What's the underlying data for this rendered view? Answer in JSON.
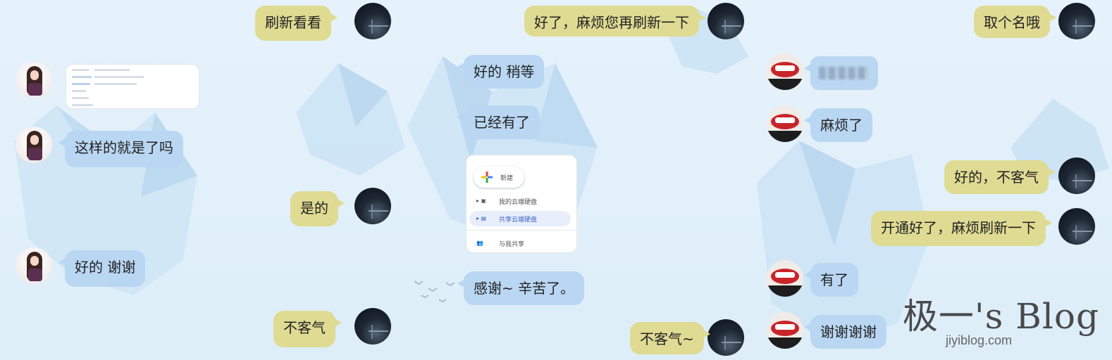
{
  "panel1": {
    "messages": [
      {
        "text": "刷新看看"
      },
      {
        "text": "这样的就是了吗"
      },
      {
        "text": "是的"
      },
      {
        "text": "好的  谢谢"
      },
      {
        "text": "不客气"
      }
    ]
  },
  "panel2": {
    "messages": [
      {
        "text": "好了，麻烦您再刷新一下"
      },
      {
        "text": "好的 稍等"
      },
      {
        "text": "已经有了"
      },
      {
        "text": "感谢~ 辛苦了。"
      },
      {
        "text": "不客气~"
      }
    ],
    "shared_screenshot": {
      "new_label": "新建",
      "items": [
        {
          "label": "我的云端硬盘"
        },
        {
          "label": "共享云端硬盘"
        },
        {
          "label": "与我共享"
        }
      ]
    }
  },
  "panel3": {
    "messages": [
      {
        "text": "取个名哦"
      },
      {
        "text": "麻烦了"
      },
      {
        "text": "好的，不客气"
      },
      {
        "text": "开通好了，麻烦刷新一下"
      },
      {
        "text": "有了"
      },
      {
        "text": "谢谢谢谢"
      }
    ],
    "watermark_title": "极一's Blog",
    "watermark_url": "jiyiblog.com"
  },
  "colors": {
    "yellow_bubble": "#dfdb93",
    "blue_bubble": "#b9d7f2",
    "background": "#e2eff9"
  }
}
